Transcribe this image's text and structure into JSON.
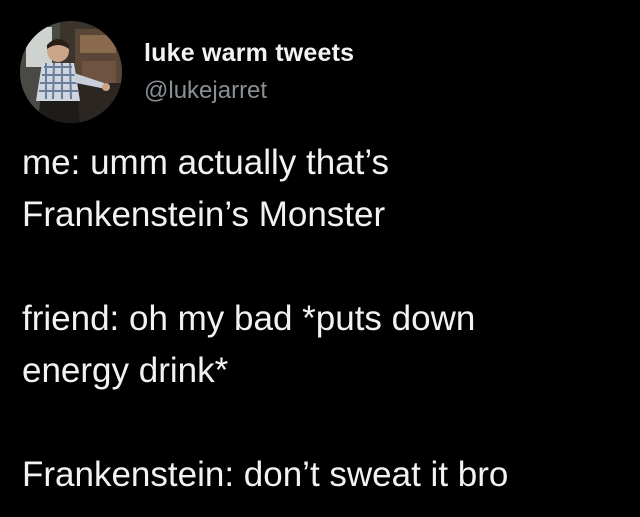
{
  "tweet": {
    "author": {
      "display_name": "luke warm tweets",
      "handle": "@lukejarret",
      "avatar_icon": "profile-photo"
    },
    "text": {
      "line1": "me: umm actually that’s",
      "line2": "Frankenstein’s Monster",
      "line3": "friend: oh my bad *puts down",
      "line4": "energy drink*",
      "line5": "Frankenstein: don’t sweat it bro"
    }
  },
  "colors": {
    "background": "#000000",
    "name": "#f3f3f3",
    "handle": "#8a8f94",
    "text": "#f2f2f2"
  }
}
